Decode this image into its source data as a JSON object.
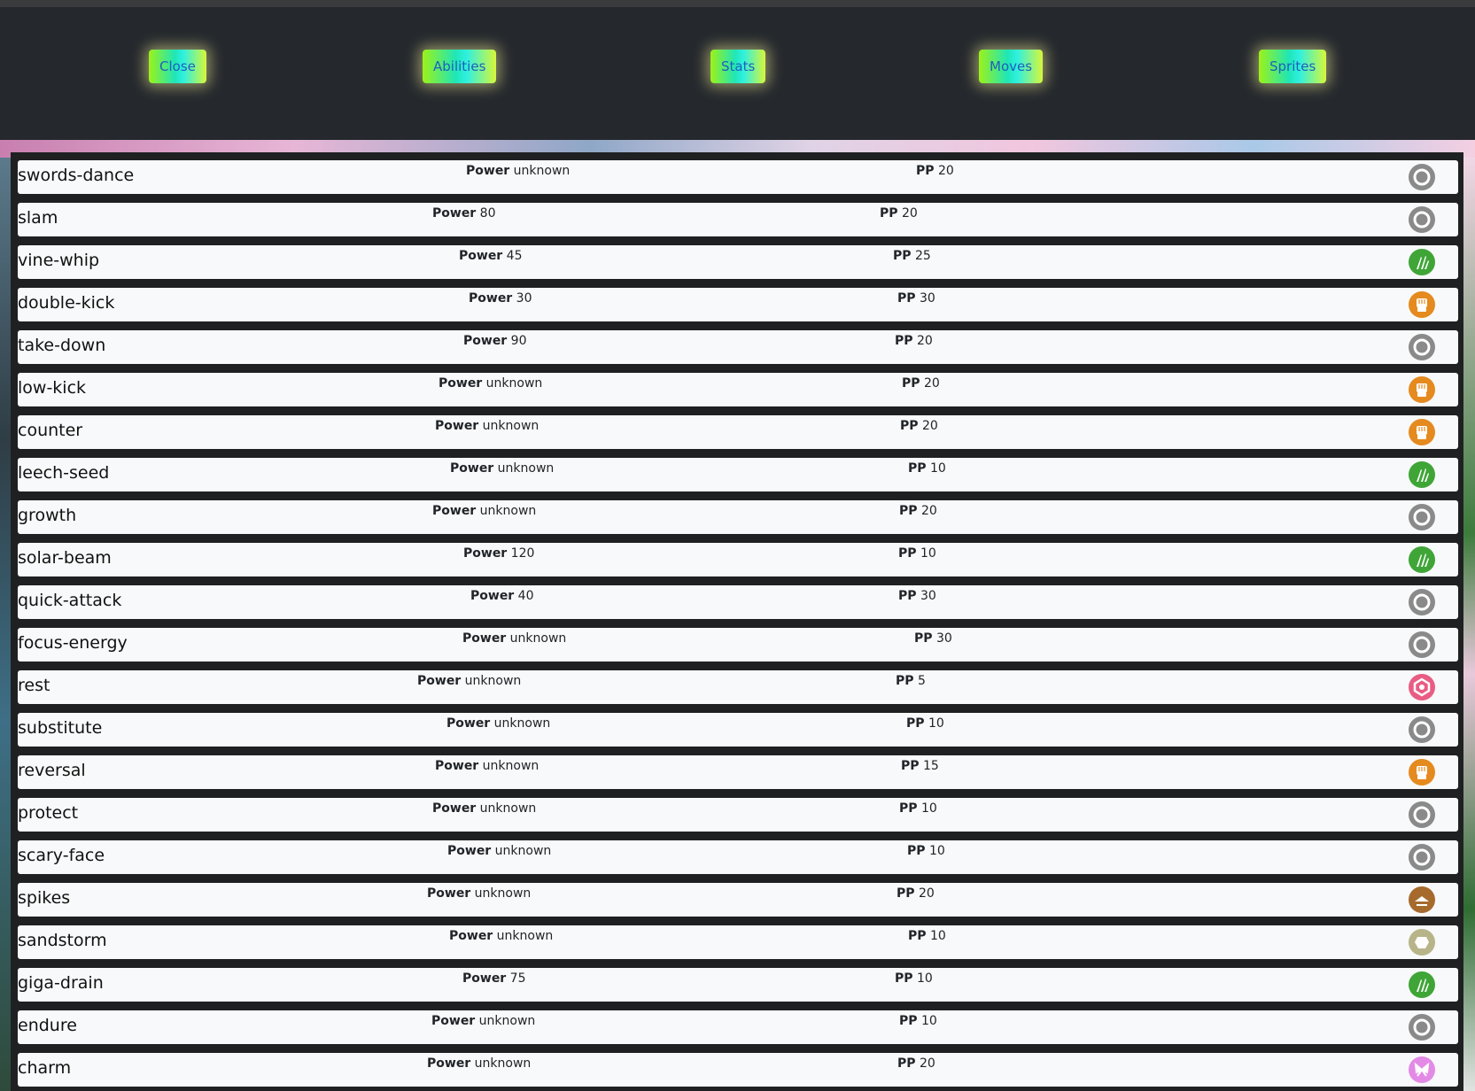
{
  "nav": {
    "buttons": [
      {
        "label": "Close"
      },
      {
        "label": "Abilities"
      },
      {
        "label": "Stats"
      },
      {
        "label": "Moves"
      },
      {
        "label": "Sprites"
      }
    ]
  },
  "labels": {
    "power": "Power",
    "pp": "PP"
  },
  "type_colors": {
    "normal": "#8a8a8a",
    "grass": "#3fa537",
    "fighting": "#e58a1f",
    "psychic": "#e95c83",
    "ground": "#a66a2c",
    "rock": "#b8b48a",
    "fairy": "#e38ae6"
  },
  "moves": [
    {
      "name": "swords-dance",
      "power": "unknown",
      "pp": "20",
      "type": "normal",
      "icon": "normal-type-icon"
    },
    {
      "name": "slam",
      "power": "80",
      "pp": "20",
      "type": "normal",
      "icon": "normal-type-icon"
    },
    {
      "name": "vine-whip",
      "power": "45",
      "pp": "25",
      "type": "grass",
      "icon": "grass-type-icon"
    },
    {
      "name": "double-kick",
      "power": "30",
      "pp": "30",
      "type": "fighting",
      "icon": "fighting-type-icon"
    },
    {
      "name": "take-down",
      "power": "90",
      "pp": "20",
      "type": "normal",
      "icon": "normal-type-icon"
    },
    {
      "name": "low-kick",
      "power": "unknown",
      "pp": "20",
      "type": "fighting",
      "icon": "fighting-type-icon"
    },
    {
      "name": "counter",
      "power": "unknown",
      "pp": "20",
      "type": "fighting",
      "icon": "fighting-type-icon"
    },
    {
      "name": "leech-seed",
      "power": "unknown",
      "pp": "10",
      "type": "grass",
      "icon": "grass-type-icon"
    },
    {
      "name": "growth",
      "power": "unknown",
      "pp": "20",
      "type": "normal",
      "icon": "normal-type-icon"
    },
    {
      "name": "solar-beam",
      "power": "120",
      "pp": "10",
      "type": "grass",
      "icon": "grass-type-icon"
    },
    {
      "name": "quick-attack",
      "power": "40",
      "pp": "30",
      "type": "normal",
      "icon": "normal-type-icon"
    },
    {
      "name": "focus-energy",
      "power": "unknown",
      "pp": "30",
      "type": "normal",
      "icon": "normal-type-icon"
    },
    {
      "name": "rest",
      "power": "unknown",
      "pp": "5",
      "type": "psychic",
      "icon": "psychic-type-icon"
    },
    {
      "name": "substitute",
      "power": "unknown",
      "pp": "10",
      "type": "normal",
      "icon": "normal-type-icon"
    },
    {
      "name": "reversal",
      "power": "unknown",
      "pp": "15",
      "type": "fighting",
      "icon": "fighting-type-icon"
    },
    {
      "name": "protect",
      "power": "unknown",
      "pp": "10",
      "type": "normal",
      "icon": "normal-type-icon"
    },
    {
      "name": "scary-face",
      "power": "unknown",
      "pp": "10",
      "type": "normal",
      "icon": "normal-type-icon"
    },
    {
      "name": "spikes",
      "power": "unknown",
      "pp": "20",
      "type": "ground",
      "icon": "ground-type-icon"
    },
    {
      "name": "sandstorm",
      "power": "unknown",
      "pp": "10",
      "type": "rock",
      "icon": "rock-type-icon"
    },
    {
      "name": "giga-drain",
      "power": "75",
      "pp": "10",
      "type": "grass",
      "icon": "grass-type-icon"
    },
    {
      "name": "endure",
      "power": "unknown",
      "pp": "10",
      "type": "normal",
      "icon": "normal-type-icon"
    },
    {
      "name": "charm",
      "power": "unknown",
      "pp": "20",
      "type": "fairy",
      "icon": "fairy-type-icon"
    }
  ]
}
